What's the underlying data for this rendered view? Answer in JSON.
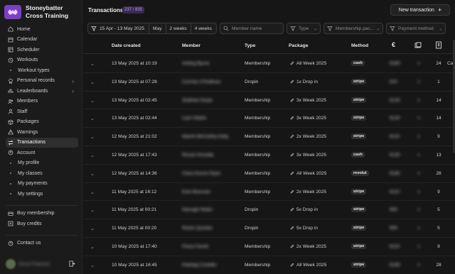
{
  "brand": {
    "line1": "Stoneybatter",
    "line2": "Cross Training"
  },
  "nav": [
    {
      "label": "Home",
      "icon": "home-icon"
    },
    {
      "label": "Calendar",
      "icon": "calendar-icon"
    },
    {
      "label": "Scheduler",
      "icon": "scheduler-icon"
    },
    {
      "label": "Workouts",
      "icon": "workouts-icon"
    },
    {
      "label": "Workout types",
      "icon": "dot-icon",
      "sub": true
    },
    {
      "label": "Personal records",
      "icon": "records-icon",
      "chevron": true
    },
    {
      "label": "Leaderboards",
      "icon": "leaderboards-icon",
      "chevron": true
    },
    {
      "label": "Members",
      "icon": "members-icon"
    },
    {
      "label": "Staff",
      "icon": "staff-icon"
    },
    {
      "label": "Packages",
      "icon": "packages-icon"
    },
    {
      "label": "Warnings",
      "icon": "warnings-icon"
    },
    {
      "label": "Transactions",
      "icon": "transactions-icon",
      "active": true
    },
    {
      "label": "Account",
      "icon": "account-icon"
    },
    {
      "label": "My profile",
      "icon": "dot-icon",
      "sub": true
    },
    {
      "label": "My classes",
      "icon": "dot-icon",
      "sub": true
    },
    {
      "label": "My payments",
      "icon": "dot-icon",
      "sub": true
    },
    {
      "label": "My settings",
      "icon": "dot-icon",
      "sub": true
    }
  ],
  "nav_bottom": [
    {
      "label": "Buy membership",
      "icon": "buy-membership-icon"
    },
    {
      "label": "Buy credits",
      "icon": "buy-credits-icon"
    }
  ],
  "contact": {
    "label": "Contact us"
  },
  "user": {
    "name": "Anna Pearson"
  },
  "header": {
    "title": "Transactions",
    "count": "237 / 835",
    "new_button": "New transaction"
  },
  "filters": {
    "date_range": "15 Apr - 13 May 2025",
    "presets": [
      "May",
      "2 weeks",
      "4 weeks"
    ],
    "member_placeholder": "Member name",
    "type_placeholder": "Type",
    "package_placeholder": "Membership pac...",
    "method_placeholder": "Payment method"
  },
  "columns": {
    "date": "Date created",
    "member": "Member",
    "type": "Type",
    "package": "Package",
    "method": "Method",
    "amount": "€",
    "credits": "credits-icon",
    "sessions": "sessions-icon"
  },
  "rows": [
    {
      "date": "13 May 2025 at 10:19",
      "member": "Aisling Byrne",
      "type": "Membership",
      "package": "All Week 2025",
      "method": "cash",
      "amount": "€180",
      "remaining": "24",
      "extra": "Ca..."
    },
    {
      "date": "13 May 2025 at 07:28",
      "member": "Cormac O'Sullivan",
      "type": "Dropin",
      "package": "1x Drop in",
      "method": "stripe",
      "amount": "€20",
      "remaining": "1",
      "extra": ""
    },
    {
      "date": "13 May 2025 at 02:45",
      "member": "Siobhan Doyle",
      "type": "Membership",
      "package": "3x Week 2025",
      "method": "stripe",
      "amount": "€130",
      "remaining": "14",
      "extra": ""
    },
    {
      "date": "13 May 2025 at 02:44",
      "member": "Liam Walsh",
      "type": "Membership",
      "package": "3x Week 2025",
      "method": "stripe",
      "amount": "€130",
      "remaining": "14",
      "extra": ""
    },
    {
      "date": "12 May 2025 at 21:02",
      "member": "Niamh McCarthy Kelly",
      "type": "Membership",
      "package": "2x Week 2025",
      "method": "stripe",
      "amount": "€110",
      "remaining": "9",
      "extra": ""
    },
    {
      "date": "12 May 2025 at 17:43",
      "member": "Ronan Kinsella",
      "type": "Membership",
      "package": "3x Week 2025",
      "method": "cash",
      "amount": "€130",
      "remaining": "13",
      "extra": ""
    },
    {
      "date": "12 May 2025 at 14:36",
      "member": "Ciara Dunne Ryan",
      "type": "Membership",
      "package": "All Week 2025",
      "method": "revolut",
      "amount": "€180",
      "remaining": "28",
      "extra": ""
    },
    {
      "date": "11 May 2025 at 16:12",
      "member": "Eoin Brennan",
      "type": "Membership",
      "package": "2x Week 2025",
      "method": "stripe",
      "amount": "€110",
      "remaining": "9",
      "extra": ""
    },
    {
      "date": "11 May 2025 at 00:21",
      "member": "Darragh Nolan",
      "type": "Dropin",
      "package": "5x Drop in",
      "method": "stripe",
      "amount": "€90",
      "remaining": "5",
      "extra": ""
    },
    {
      "date": "11 May 2025 at 00:20",
      "member": "Roisin Quinlan",
      "type": "Dropin",
      "package": "5x Drop in",
      "method": "stripe",
      "amount": "€90",
      "remaining": "5",
      "extra": ""
    },
    {
      "date": "10 May 2025 at 17:40",
      "member": "Fiona Farrell",
      "type": "Membership",
      "package": "2x Week 2025",
      "method": "stripe",
      "amount": "€110",
      "remaining": "9",
      "extra": ""
    },
    {
      "date": "10 May 2025 at 16:45",
      "member": "Padraig Costello",
      "type": "Membership",
      "package": "All Week 2025",
      "method": "stripe",
      "amount": "€180",
      "remaining": "28",
      "extra": ""
    }
  ]
}
